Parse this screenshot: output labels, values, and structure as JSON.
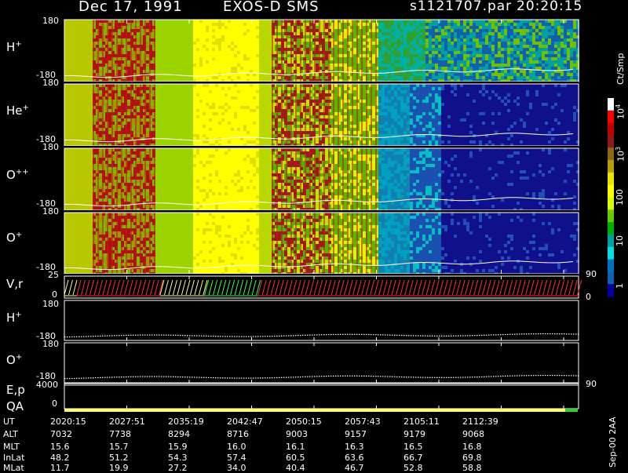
{
  "header": {
    "date": "Dec 17, 1991",
    "instrument": "EXOS-D SMS",
    "file": "s1121707.par",
    "time": "20:20:15"
  },
  "chart_data": [
    {
      "type": "heatmap",
      "panel": "H+",
      "label": "H",
      "sup": "+",
      "yticks": [
        "180",
        "-180"
      ],
      "ylim": [
        -180,
        180
      ]
    },
    {
      "type": "heatmap",
      "panel": "He+",
      "label": "He",
      "sup": "+",
      "yticks": [
        "180",
        "-180"
      ],
      "ylim": [
        -180,
        180
      ]
    },
    {
      "type": "heatmap",
      "panel": "O++",
      "label": "O",
      "sup": "++",
      "yticks": [
        "180",
        "-180"
      ],
      "ylim": [
        -180,
        180
      ]
    },
    {
      "type": "heatmap",
      "panel": "O+",
      "label": "O",
      "sup": "+",
      "yticks": [
        "180",
        "-180"
      ],
      "ylim": [
        -180,
        180
      ]
    },
    {
      "type": "line",
      "panel": "V,r",
      "label": "V,r",
      "yticks": [
        "25",
        "0"
      ],
      "right_ticks": [
        "90",
        "0"
      ],
      "segments": [
        {
          "color": "#ffff80",
          "from": "20:20:15",
          "to": "20:21:40"
        },
        {
          "color": "#ff3030",
          "from": "20:21:40",
          "to": "20:31:00"
        },
        {
          "color": "#ffff80",
          "from": "20:31:00",
          "to": "20:36:00"
        },
        {
          "color": "#40ff40",
          "from": "20:36:00",
          "to": "20:42:00"
        },
        {
          "color": "#ff3030",
          "from": "20:42:00",
          "to": "21:18:00"
        }
      ]
    },
    {
      "type": "line",
      "panel": "H+ angle",
      "label": "H",
      "sup": "+",
      "yticks": [
        "180",
        "-180"
      ]
    },
    {
      "type": "line",
      "panel": "O+ angle",
      "label": "O",
      "sup": "+",
      "yticks": [
        "180",
        "-180"
      ]
    },
    {
      "type": "line",
      "panel": "E,p",
      "label": "E,p",
      "yticks": [
        "4000"
      ],
      "right_ticks": [
        "90"
      ]
    },
    {
      "type": "bar",
      "panel": "QA",
      "label": "QA",
      "yticks": [
        "0"
      ]
    }
  ],
  "colorbar": {
    "unit": "Ct/Smp",
    "ticks": [
      {
        "base": "10",
        "exp": "4"
      },
      {
        "base": "10",
        "exp": "3"
      },
      {
        "base": "100",
        "exp": ""
      },
      {
        "base": "10",
        "exp": ""
      },
      {
        "base": "1",
        "exp": ""
      }
    ],
    "colors": [
      "#ffffff",
      "#ff0000",
      "#c00000",
      "#8b1a1a",
      "#8b6914",
      "#b8a000",
      "#e6e600",
      "#ffff00",
      "#d4ff00",
      "#66cc00",
      "#00b000",
      "#00a0a0",
      "#00e0e0",
      "#0070c0",
      "#1060b0",
      "#0000a0"
    ]
  },
  "footer": {
    "rows": [
      {
        "name": "UT",
        "values": [
          "2020:15",
          "2027:51",
          "2035:19",
          "2042:47",
          "2050:15",
          "2057:43",
          "2105:11",
          "2112:39"
        ]
      },
      {
        "name": "ALT",
        "values": [
          "7032",
          "7738",
          "8294",
          "8716",
          "9003",
          "9157",
          "9179",
          "9068"
        ]
      },
      {
        "name": "MLT",
        "values": [
          "15.6",
          "15.7",
          "15.9",
          "16.0",
          "16.1",
          "16.3",
          "16.5",
          "16.8"
        ]
      },
      {
        "name": "InLat",
        "values": [
          "48.2",
          "51.2",
          "54.3",
          "57.4",
          "60.5",
          "63.6",
          "66.7",
          "69.8"
        ]
      },
      {
        "name": "MLat",
        "values": [
          "11.7",
          "19.9",
          "27.2",
          "34.0",
          "40.4",
          "46.7",
          "52.8",
          "58.8"
        ]
      }
    ],
    "version": "Sep-00 2AA"
  }
}
